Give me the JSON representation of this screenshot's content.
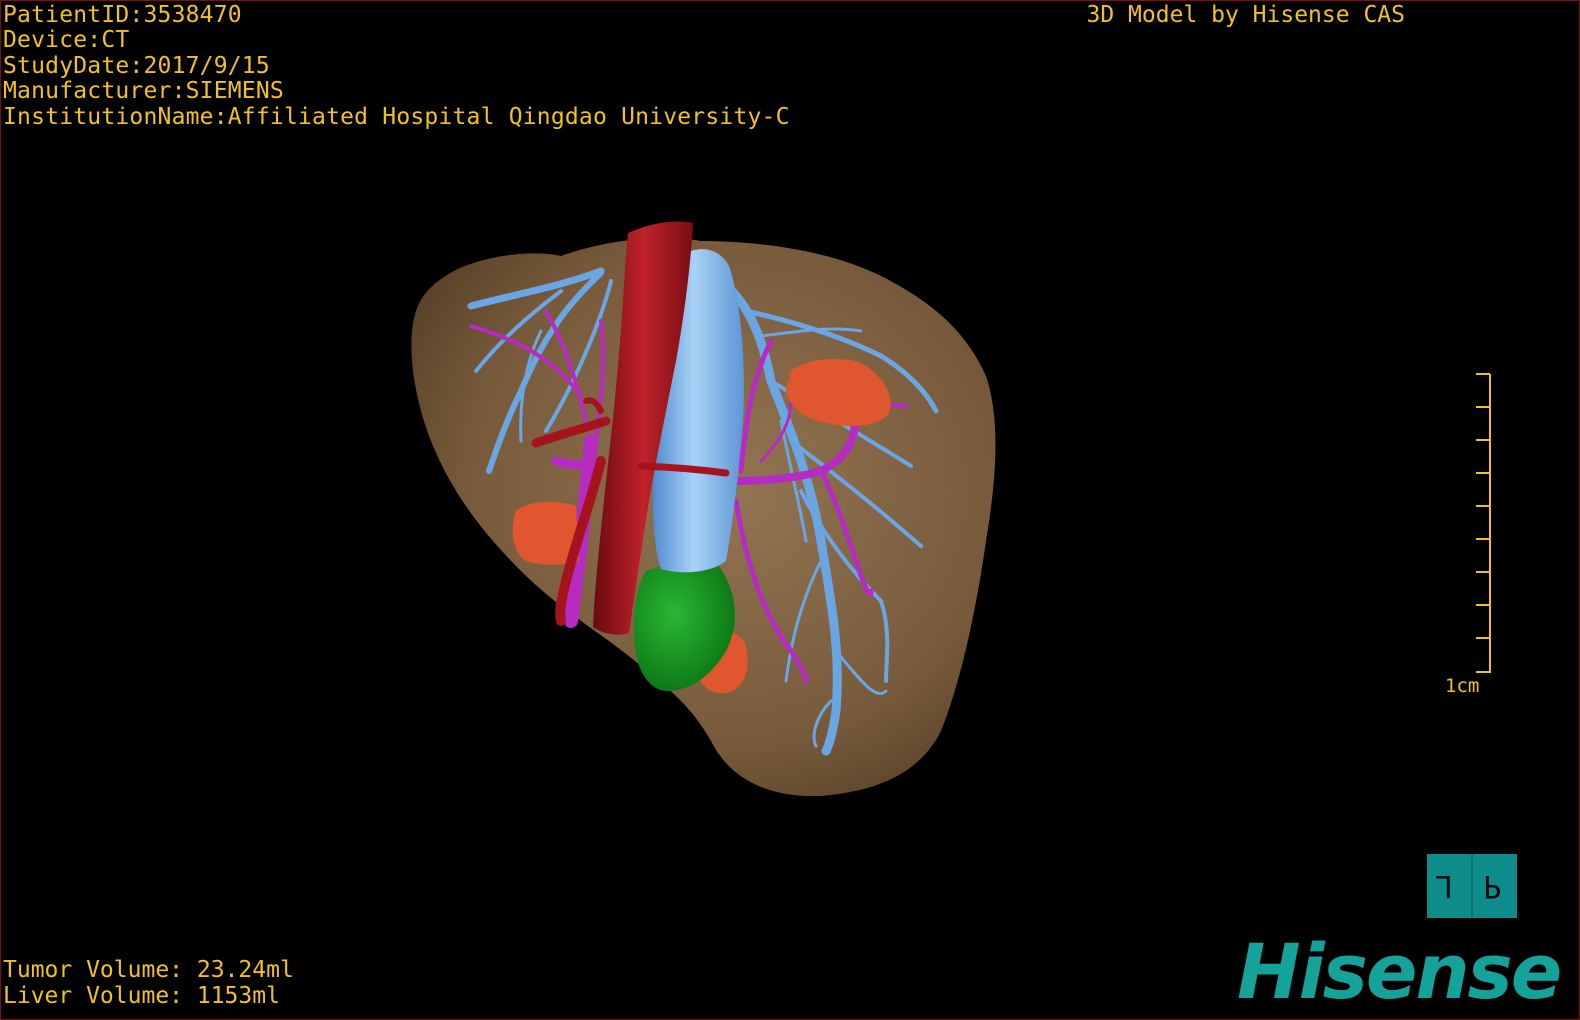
{
  "viewer": {
    "patient_info": [
      "PatientID:3538470",
      "Device:CT",
      "StudyDate:2017/9/15",
      "Manufacturer:SIEMENS",
      "InstitutionName:Affiliated Hospital Qingdao University-C"
    ],
    "model_credit": "3D Model by Hisense CAS",
    "volumes": [
      "Tumor Volume: 23.24ml",
      "Liver Volume: 1153ml"
    ],
    "scale_label": "1cm",
    "orientation": {
      "left": "L",
      "right": "P"
    },
    "brand": "Hisense"
  },
  "colors": {
    "text": "#f2c21c",
    "liver": "#8a6a45",
    "artery": "#a5141c",
    "portal_vein": "#b52bc4",
    "hepatic_vein": "#6aa6e4",
    "tumor": "#e0562e",
    "gallbladder": "#159a20",
    "brand": "#14a29a"
  }
}
